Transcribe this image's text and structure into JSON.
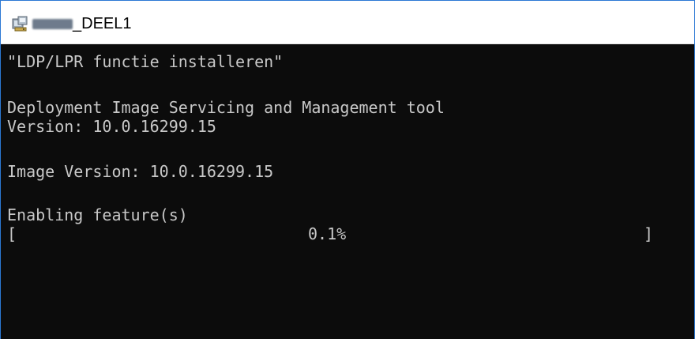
{
  "window": {
    "title_suffix": "_DEEL1",
    "icon": "batch-file-icon"
  },
  "console": {
    "line1": "\"LDP/LPR functie installeren\"",
    "line2": "Deployment Image Servicing and Management tool",
    "line3": "Version: 10.0.16299.15",
    "line4": "Image Version: 10.0.16299.15",
    "line5": "Enabling feature(s)",
    "progress": {
      "open_bracket": "[",
      "percent_text": "0.1%",
      "close_bracket": "]",
      "value": 0.001
    }
  }
}
